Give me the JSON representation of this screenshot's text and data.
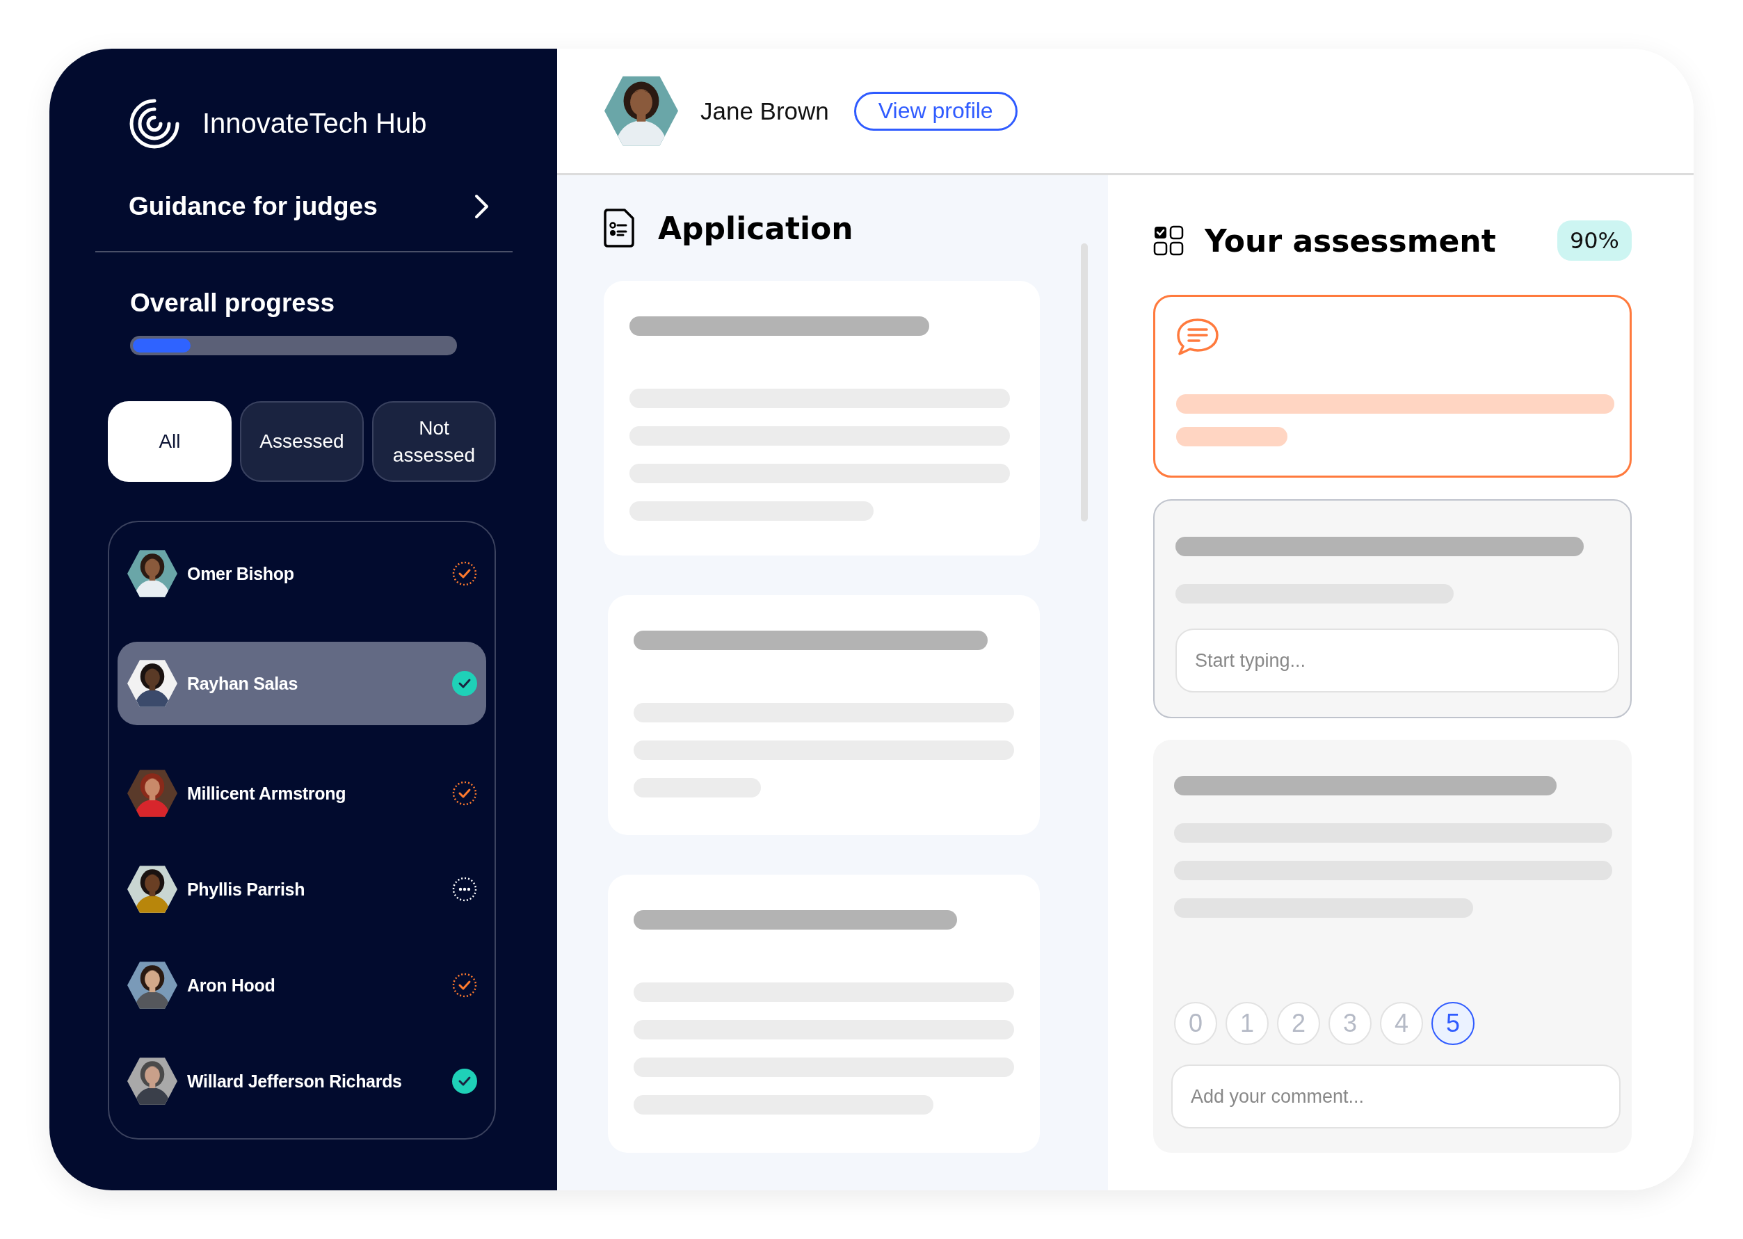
{
  "brand": {
    "name": "InnovateTech Hub"
  },
  "guidance": {
    "label": "Guidance for judges"
  },
  "progress": {
    "label": "Overall progress",
    "level": 0.18
  },
  "filters": [
    {
      "label": "All",
      "selected": true
    },
    {
      "label": "Assessed",
      "selected": false
    },
    {
      "label": "Not assessed",
      "selected": false
    }
  ],
  "candidates": [
    {
      "name": "Omer Bishop",
      "kind": "pending",
      "selected": false
    },
    {
      "name": "Rayhan Salas",
      "kind": "done",
      "selected": true
    },
    {
      "name": "Millicent Armstrong",
      "kind": "pending",
      "selected": false
    },
    {
      "name": "Phyllis Parrish",
      "kind": "waiting",
      "selected": false
    },
    {
      "name": "Aron Hood",
      "kind": "pending",
      "selected": false
    },
    {
      "name": "Willard Jefferson Richards",
      "kind": "done",
      "selected": false
    }
  ],
  "header": {
    "name": "Jane Brown",
    "profile_link": "View profile"
  },
  "application": {
    "title": "Application"
  },
  "assessment": {
    "title": "Your assessment",
    "score": "90%",
    "answer_placeholder": "Start typing...",
    "comment_placeholder": "Add your comment...",
    "rating": [
      {
        "label": "0",
        "selected": false
      },
      {
        "label": "1",
        "selected": false
      },
      {
        "label": "2",
        "selected": false
      },
      {
        "label": "3",
        "selected": false
      },
      {
        "label": "4",
        "selected": false
      },
      {
        "label": "5",
        "selected": true
      }
    ]
  }
}
